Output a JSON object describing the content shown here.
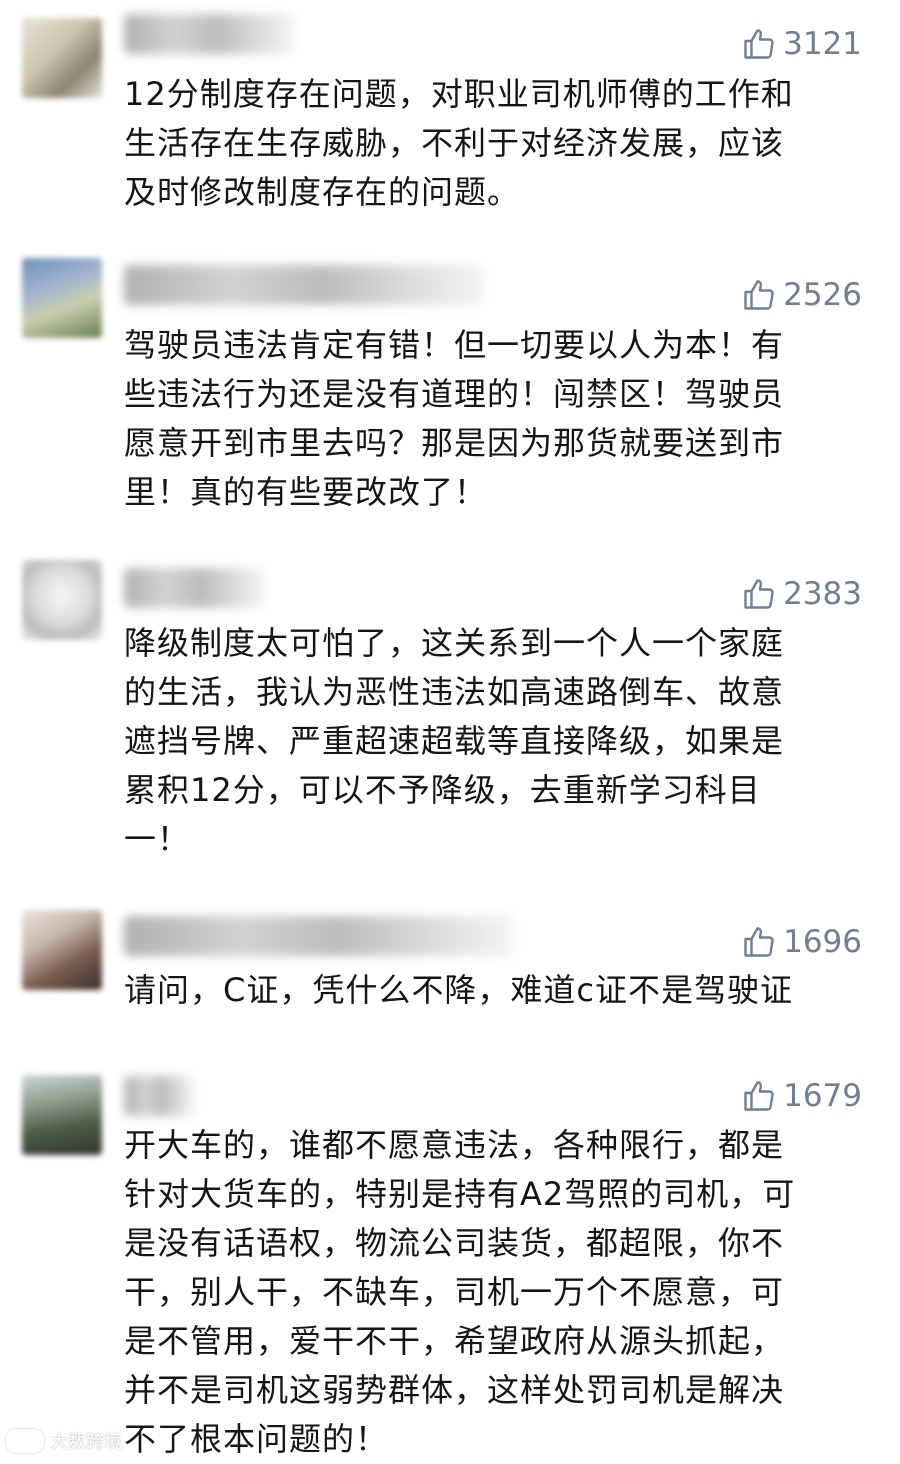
{
  "comments": [
    {
      "likes": "3121",
      "lines": [
        "12分制度存在问题，对职业司机师傅的工作和",
        "生活存在生存威胁，不利于对经济发展，应该",
        "及时修改制度存在的问题。"
      ]
    },
    {
      "likes": "2526",
      "lines": [
        "驾驶员违法肯定有错！但一切要以人为本！有",
        "些违法行为还是没有道理的！闯禁区！驾驶员",
        "愿意开到市里去吗？那是因为那货就要送到市",
        "里！真的有些要改改了！"
      ]
    },
    {
      "likes": "2383",
      "lines": [
        "降级制度太可怕了，这关系到一个人一个家庭",
        "的生活，我认为恶性违法如高速路倒车、故意",
        "遮挡号牌、严重超速超载等直接降级，如果是",
        "累积12分，可以不予降级，去重新学习科目",
        "一！"
      ]
    },
    {
      "likes": "1696",
      "lines": [
        "请问，C证，凭什么不降，难道c证不是驾驶证"
      ]
    },
    {
      "likes": "1679",
      "lines": [
        "开大车的，谁都不愿意违法，各种限行，都是",
        "针对大货车的，特别是持有A2驾照的司机，可",
        "是没有话语权，物流公司装货，都超限，你不",
        "干，别人干，不缺车，司机一万个不愿意，可",
        "是不管用，爱干不干，希望政府从源头抓起，",
        "并不是司机这弱势群体，这样处罚司机是解决",
        "不了根本问题的！"
      ]
    }
  ],
  "watermark": "大数跨境",
  "colors": {
    "like": "#6f7f96",
    "text": "#151515"
  },
  "icons": {
    "like": "thumbs-up-outline"
  }
}
